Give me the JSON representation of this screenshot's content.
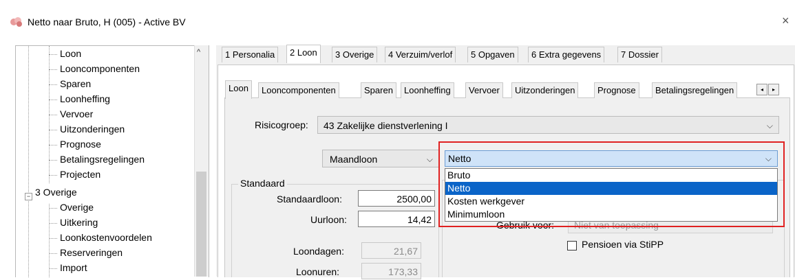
{
  "window": {
    "title": "Netto naar Bruto, H (005) - Active BV",
    "close_glyph": "×",
    "icon": "app-logo-icon"
  },
  "tree": {
    "items": [
      {
        "label": "Loon"
      },
      {
        "label": "Looncomponenten"
      },
      {
        "label": "Sparen"
      },
      {
        "label": "Loonheffing"
      },
      {
        "label": "Vervoer"
      },
      {
        "label": "Uitzonderingen"
      },
      {
        "label": "Prognose"
      },
      {
        "label": "Betalingsregelingen"
      },
      {
        "label": "Projecten"
      },
      {
        "label": "3 Overige",
        "expander": "−"
      },
      {
        "label": "Overige"
      },
      {
        "label": "Uitkering"
      },
      {
        "label": "Loonkostenvoordelen"
      },
      {
        "label": "Reserveringen"
      },
      {
        "label": "Import"
      }
    ],
    "scroll_up_glyph": "^"
  },
  "tabs_main": [
    {
      "label": "1 Personalia"
    },
    {
      "label": "2 Loon",
      "active": true
    },
    {
      "label": "3 Overige"
    },
    {
      "label": "4 Verzuim/verlof"
    },
    {
      "label": "5 Opgaven"
    },
    {
      "label": "6 Extra gegevens"
    },
    {
      "label": "7 Dossier"
    }
  ],
  "tabs_sub": [
    {
      "label": "Loon",
      "active": true
    },
    {
      "label": "Looncomponenten"
    },
    {
      "label": "Sparen"
    },
    {
      "label": "Loonheffing"
    },
    {
      "label": "Vervoer"
    },
    {
      "label": "Uitzonderingen"
    },
    {
      "label": "Prognose"
    },
    {
      "label": "Betalingsregelingen"
    }
  ],
  "tab_scroll": {
    "left": "◂",
    "right": "▸"
  },
  "form": {
    "risicogroep_label": "Risicogroep:",
    "risicogroep_value": "43 Zakelijke dienstverlening I",
    "loontype_value": "Maandloon",
    "netto_value": "Netto",
    "dropdown_options": [
      "Bruto",
      "Netto",
      "Kosten werkgever",
      "Minimumloon"
    ],
    "dropdown_selected": "Netto",
    "standaard_group": "Standaard",
    "standaardloon_label": "Standaardloon:",
    "standaardloon_value": "2500,00",
    "uurloon_label": "Uurloon:",
    "uurloon_value": "14,42",
    "loondagen_label": "Loondagen:",
    "loondagen_value": "21,67",
    "loonuren_label": "Loonuren:",
    "loonuren_value": "173,33",
    "gebruik_label": "Gebruik voor:",
    "gebruik_value": "Niet van toepassing",
    "pensioen_label": "Pensioen via StiPP",
    "chevron": "⌵"
  },
  "colors": {
    "highlight": "#e02020",
    "selection": "#0a64c8"
  }
}
